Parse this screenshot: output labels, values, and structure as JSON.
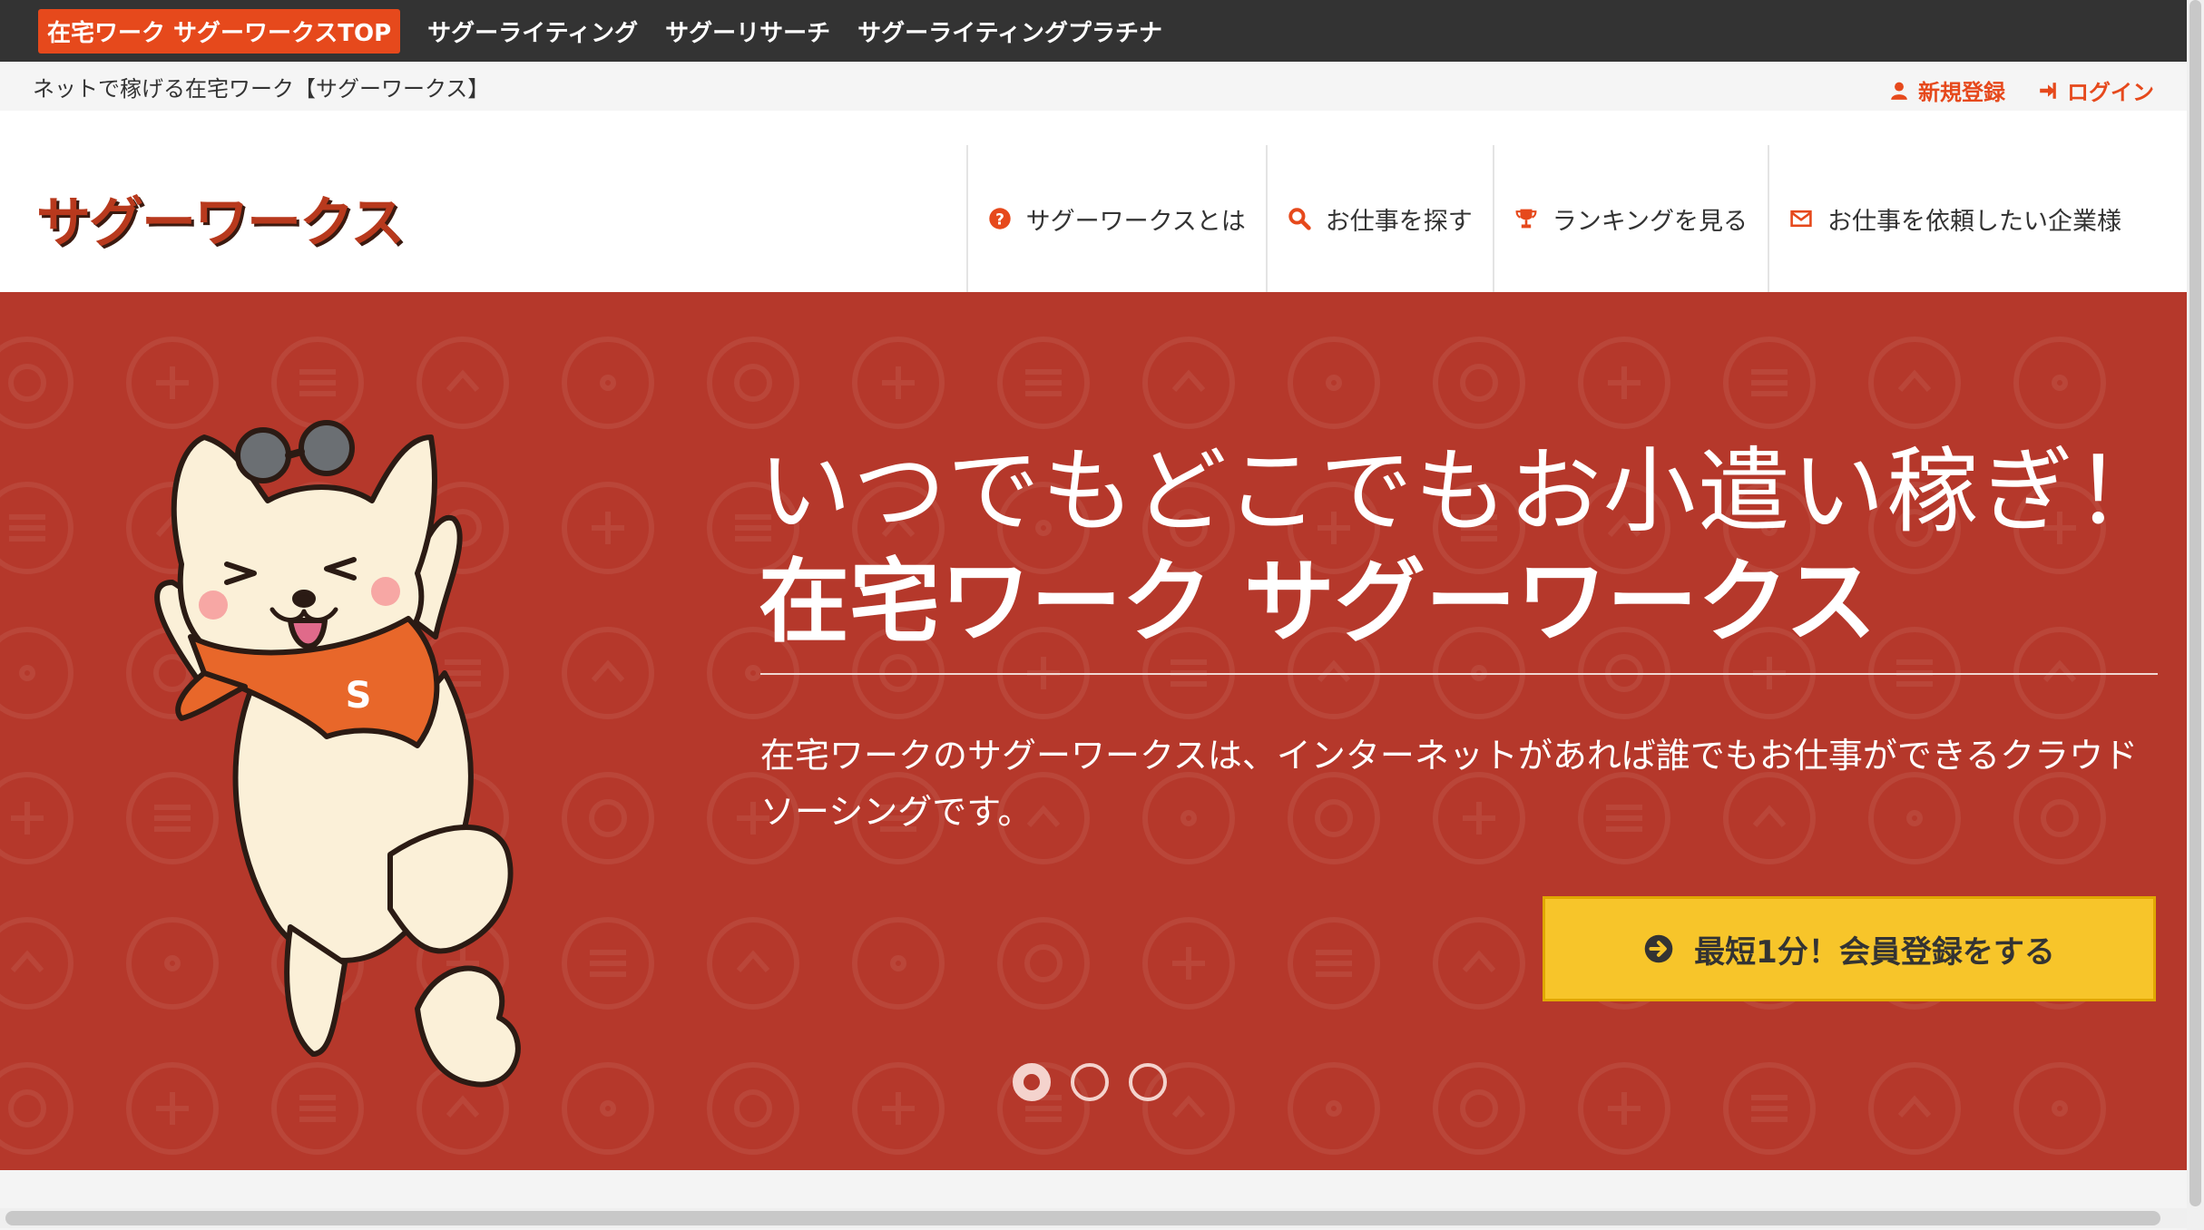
{
  "topbar": {
    "links": [
      {
        "label": "在宅ワーク サグーワークスTOP",
        "active": true
      },
      {
        "label": "サグーライティング",
        "active": false
      },
      {
        "label": "サグーリサーチ",
        "active": false
      },
      {
        "label": "サグーライティングプラチナ",
        "active": false
      }
    ]
  },
  "subheader": {
    "tagline": "ネットで稼げる在宅ワーク【サグーワークス】",
    "register": "新規登録",
    "login": "ログイン"
  },
  "header": {
    "logo": "サグーワークス",
    "nav": [
      {
        "label": "サグーワークスとは",
        "icon": "question-circle-icon"
      },
      {
        "label": "お仕事を探す",
        "icon": "search-icon"
      },
      {
        "label": "ランキングを見る",
        "icon": "trophy-icon"
      },
      {
        "label": "お仕事を依頼したい企業様",
        "icon": "envelope-icon"
      }
    ]
  },
  "hero": {
    "title_line1": "いつでもどこでもお小遣い稼ぎ！",
    "title_line2": "在宅ワーク サグーワークス",
    "description": "在宅ワークのサグーワークスは、インターネットがあれば誰でもお仕事ができるクラウドソーシングです。",
    "cta": "最短1分！会員登録をする",
    "mascot_badge": "S",
    "slides": 3,
    "active_slide": 1
  },
  "colors": {
    "accent": "#e6491c",
    "hero_bg": "#b5382b",
    "cta_bg": "#f7c52a",
    "topbar_bg": "#333333"
  }
}
